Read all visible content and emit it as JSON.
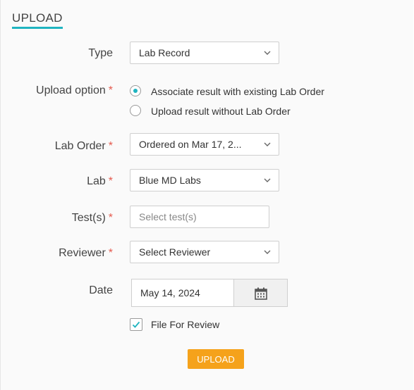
{
  "header": {
    "title": "UPLOAD"
  },
  "form": {
    "type": {
      "label": "Type",
      "value": "Lab Record"
    },
    "upload_option": {
      "label": "Upload option",
      "required_mark": "*",
      "options": [
        {
          "label": "Associate result with existing Lab Order",
          "selected": true
        },
        {
          "label": "Upload result without Lab Order",
          "selected": false
        }
      ]
    },
    "lab_order": {
      "label": "Lab Order",
      "required_mark": "*",
      "value": "Ordered on Mar 17, 2..."
    },
    "lab": {
      "label": "Lab",
      "required_mark": "*",
      "value": "Blue MD Labs"
    },
    "tests": {
      "label": "Test(s)",
      "required_mark": "*",
      "value": "",
      "placeholder": "Select test(s)"
    },
    "reviewer": {
      "label": "Reviewer",
      "required_mark": "*",
      "value": "Select Reviewer"
    },
    "date": {
      "label": "Date",
      "value": "May 14, 2024",
      "icon": "calendar-icon"
    },
    "file_for_review": {
      "label": "File For Review",
      "checked": true
    }
  },
  "actions": {
    "upload_label": "UPLOAD"
  },
  "colors": {
    "accent": "#1fb4c0",
    "button": "#f5a21b",
    "required": "#e55a4e"
  }
}
